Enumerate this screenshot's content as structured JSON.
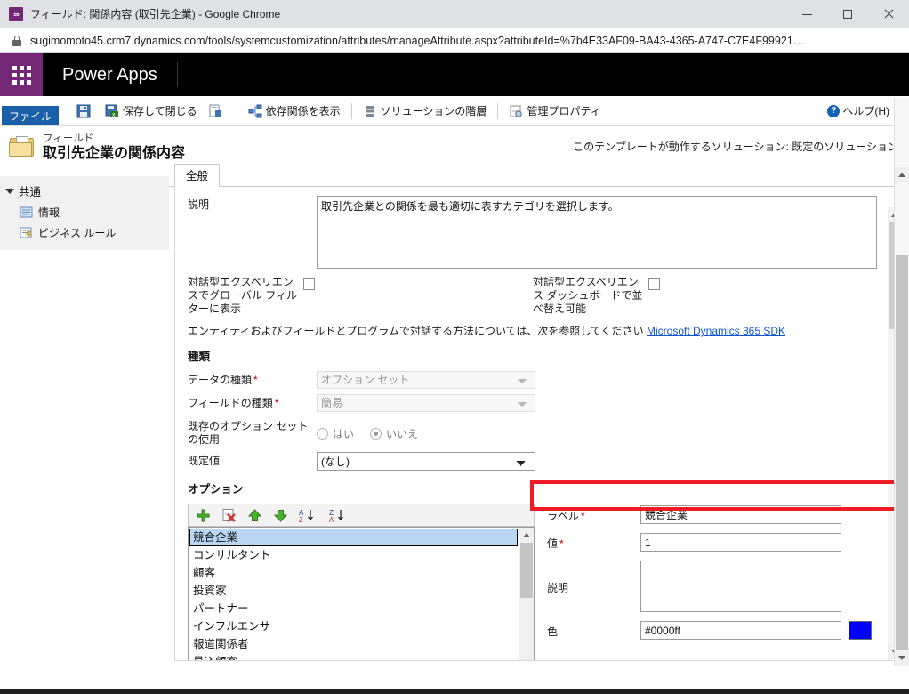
{
  "browser": {
    "window_title": "フィールド: 関係内容 (取引先企業) - Google Chrome",
    "favicon_glyph": "∞",
    "url": "sugimomoto45.crm7.dynamics.com/tools/systemcustomization/attributes/manageAttribute.aspx?attributeId=%7b4E33AF09-BA43-4365-A747-C7E4F99921…",
    "controls": {
      "minimize": "—",
      "maximize": "□",
      "close": "✕"
    }
  },
  "app_header": {
    "title": "Power Apps",
    "waffle_icon": "waffle-icon",
    "brand_color": "#742774"
  },
  "ribbon": {
    "file_tab": "ファイル",
    "items": [
      {
        "label": "",
        "icon": "save-icon"
      },
      {
        "label": "保存して閉じる",
        "icon": "save-and-close-icon"
      },
      {
        "label": "",
        "icon": "new-icon"
      },
      {
        "label": "依存関係を表示",
        "icon": "dependencies-icon"
      },
      {
        "label": "ソリューションの階層",
        "icon": "solution-layers-icon"
      },
      {
        "label": "管理プロパティ",
        "icon": "managed-properties-icon"
      }
    ],
    "help_label": "ヘルプ(H)",
    "help_icon": "help-circle-icon"
  },
  "page_header": {
    "kicker": "フィールド",
    "title": "取引先企業の関係内容",
    "solution_note": "このテンプレートが動作するソリューション: 既定のソリューション",
    "folder_icon": "folder-icon"
  },
  "sidebar": {
    "group_label": "共通",
    "items": [
      {
        "label": "情報",
        "icon": "information-icon"
      },
      {
        "label": "ビジネス ルール",
        "icon": "business-rules-icon"
      }
    ]
  },
  "tabs": [
    {
      "label": "全般",
      "active": true
    }
  ],
  "form": {
    "description_label": "説明",
    "description_value": "取引先企業との関係を最も適切に表すカテゴリを選択します。",
    "checkbox_left_label": "対話型エクスペリエンスでグローバル フィルターに表示",
    "checkbox_left_checked": false,
    "checkbox_right_label": "対話型エクスペリエンス ダッシュボードで並べ替え可能",
    "checkbox_right_checked": false,
    "sdk_note": "エンティティおよびフィールドとプログラムで対話する方法については、次を参照してください ",
    "sdk_link": "Microsoft Dynamics 365 SDK",
    "type_section_label": "種類",
    "data_type_label": "データの種類",
    "data_type_value": "オプション セット",
    "field_type_label": "フィールドの種類",
    "field_type_value": "簡易",
    "use_existing_label": "既存のオプション セットの使用",
    "radio_yes": "はい",
    "radio_no": "いいえ",
    "radio_selected": "いいえ",
    "default_value_label": "既定値",
    "default_value_value": "(なし)",
    "options_section_label": "オプション",
    "options_toolbar": [
      {
        "name": "add-option-button",
        "icon": "plus-icon"
      },
      {
        "name": "delete-option-button",
        "icon": "delete-icon"
      },
      {
        "name": "move-up-button",
        "icon": "arrow-up-icon"
      },
      {
        "name": "move-down-button",
        "icon": "arrow-down-icon"
      },
      {
        "name": "sort-asc-button",
        "icon": "sort-az-icon"
      },
      {
        "name": "sort-desc-button",
        "icon": "sort-za-icon"
      }
    ],
    "options": [
      "競合企業",
      "コンサルタント",
      "顧客",
      "投資家",
      "パートナー",
      "インフルエンサ",
      "報道関係者",
      "見込顧客"
    ],
    "selected_option": "競合企業",
    "detail": {
      "label_label": "ラベル",
      "label_value": "競合企業",
      "value_label": "値",
      "value_value": "1",
      "description_label": "説明",
      "description_value": "",
      "color_label": "色",
      "color_value": "#0000ff",
      "color_swatch": "#0000ff"
    },
    "required_marker": "*"
  },
  "annotation": {
    "color": "#ee1c25",
    "target": "value-field-row"
  }
}
